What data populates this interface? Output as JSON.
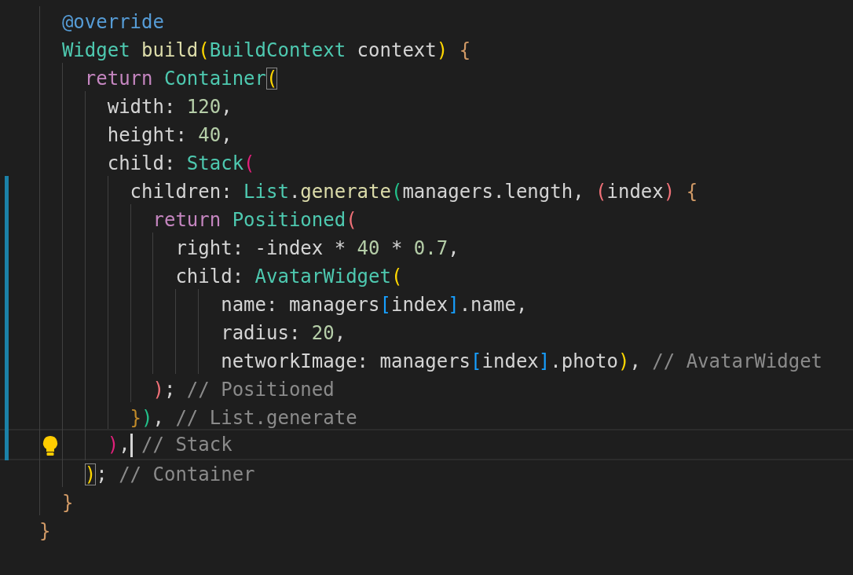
{
  "editor": {
    "lines": [
      {
        "tokens": [
          {
            "text": "  @override",
            "kind": "decorator"
          }
        ]
      },
      {
        "tokens": [
          {
            "text": "  Widget",
            "kind": "type"
          },
          {
            "text": " build",
            "kind": "function"
          },
          {
            "text": "(",
            "kind": "bracket",
            "color": "#ffd700"
          },
          {
            "text": "BuildContext",
            "kind": "type"
          },
          {
            "text": " context",
            "kind": "plain"
          },
          {
            "text": ")",
            "kind": "bracket",
            "color": "#ffd700"
          },
          {
            "text": " {",
            "kind": "bracket",
            "color": "#d19a66"
          }
        ]
      },
      {
        "tokens": [
          {
            "text": "    return",
            "kind": "keyword"
          },
          {
            "text": " Container",
            "kind": "type"
          },
          {
            "text": "(",
            "kind": "bracket",
            "color": "#ffd700",
            "matched": true
          }
        ]
      },
      {
        "tokens": [
          {
            "text": "      width: ",
            "kind": "plain"
          },
          {
            "text": "120",
            "kind": "number"
          },
          {
            "text": ",",
            "kind": "plain"
          }
        ]
      },
      {
        "tokens": [
          {
            "text": "      height: ",
            "kind": "plain"
          },
          {
            "text": "40",
            "kind": "number"
          },
          {
            "text": ",",
            "kind": "plain"
          }
        ]
      },
      {
        "tokens": [
          {
            "text": "      child: ",
            "kind": "plain"
          },
          {
            "text": "Stack",
            "kind": "type"
          },
          {
            "text": "(",
            "kind": "bracket",
            "color": "#e0207a"
          }
        ]
      },
      {
        "modified": true,
        "tokens": [
          {
            "text": "        children: ",
            "kind": "plain"
          },
          {
            "text": "List",
            "kind": "type"
          },
          {
            "text": ".",
            "kind": "plain"
          },
          {
            "text": "generate",
            "kind": "function"
          },
          {
            "text": "(",
            "kind": "bracket",
            "color": "#23c08a"
          },
          {
            "text": "managers.length, ",
            "kind": "plain"
          },
          {
            "text": "(",
            "kind": "bracket",
            "color": "#f07178"
          },
          {
            "text": "index",
            "kind": "plain"
          },
          {
            "text": ")",
            "kind": "bracket",
            "color": "#f07178"
          },
          {
            "text": " {",
            "kind": "bracket",
            "color": "#d19a66"
          }
        ]
      },
      {
        "modified": true,
        "tokens": [
          {
            "text": "          return",
            "kind": "keyword"
          },
          {
            "text": " Positioned",
            "kind": "type"
          },
          {
            "text": "(",
            "kind": "bracket",
            "color": "#f07178"
          }
        ]
      },
      {
        "modified": true,
        "tokens": [
          {
            "text": "            right: -index * ",
            "kind": "plain"
          },
          {
            "text": "40",
            "kind": "number"
          },
          {
            "text": " * ",
            "kind": "plain"
          },
          {
            "text": "0.7",
            "kind": "number"
          },
          {
            "text": ",",
            "kind": "plain"
          }
        ]
      },
      {
        "modified": true,
        "tokens": [
          {
            "text": "            child: ",
            "kind": "plain"
          },
          {
            "text": "AvatarWidget",
            "kind": "type"
          },
          {
            "text": "(",
            "kind": "bracket",
            "color": "#ffd700"
          }
        ]
      },
      {
        "modified": true,
        "tokens": [
          {
            "text": "                name: managers",
            "kind": "plain"
          },
          {
            "text": "[",
            "kind": "bracket",
            "color": "#179fff"
          },
          {
            "text": "index",
            "kind": "plain"
          },
          {
            "text": "]",
            "kind": "bracket",
            "color": "#179fff"
          },
          {
            "text": ".name,",
            "kind": "plain"
          }
        ]
      },
      {
        "modified": true,
        "tokens": [
          {
            "text": "                radius: ",
            "kind": "plain"
          },
          {
            "text": "20",
            "kind": "number"
          },
          {
            "text": ",",
            "kind": "plain"
          }
        ]
      },
      {
        "modified": true,
        "tokens": [
          {
            "text": "                networkImage: managers",
            "kind": "plain"
          },
          {
            "text": "[",
            "kind": "bracket",
            "color": "#179fff"
          },
          {
            "text": "index",
            "kind": "plain"
          },
          {
            "text": "]",
            "kind": "bracket",
            "color": "#179fff"
          },
          {
            "text": ".photo",
            "kind": "plain"
          },
          {
            "text": ")",
            "kind": "bracket",
            "color": "#ffd700"
          },
          {
            "text": ",",
            "kind": "plain"
          },
          {
            "text": " // AvatarWidget",
            "kind": "comment"
          }
        ]
      },
      {
        "modified": true,
        "tokens": [
          {
            "text": "          )",
            "kind": "bracket",
            "color": "#f07178"
          },
          {
            "text": ";",
            "kind": "plain"
          },
          {
            "text": " // Positioned",
            "kind": "comment"
          }
        ]
      },
      {
        "modified": true,
        "tokens": [
          {
            "text": "        }",
            "kind": "bracket",
            "color": "#c08a2a"
          },
          {
            "text": ")",
            "kind": "bracket",
            "color": "#23c08a"
          },
          {
            "text": ",",
            "kind": "plain"
          },
          {
            "text": " // List.generate",
            "kind": "comment"
          }
        ]
      },
      {
        "modified": true,
        "current": true,
        "lightbulb": true,
        "tokens": [
          {
            "text": "      )",
            "kind": "bracket",
            "color": "#e0207a"
          },
          {
            "text": ",",
            "kind": "plain",
            "cursor_after": true
          },
          {
            "text": " // Stack",
            "kind": "comment"
          }
        ]
      },
      {
        "tokens": [
          {
            "text": "    )",
            "kind": "bracket",
            "color": "#ffd700",
            "matched": true
          },
          {
            "text": ";",
            "kind": "plain"
          },
          {
            "text": " // Container",
            "kind": "comment"
          }
        ]
      },
      {
        "tokens": [
          {
            "text": "  }",
            "kind": "bracket",
            "color": "#d19a66"
          }
        ]
      },
      {
        "tokens": [
          {
            "text": "}",
            "kind": "bracket",
            "color": "#d19a66"
          }
        ]
      }
    ]
  }
}
